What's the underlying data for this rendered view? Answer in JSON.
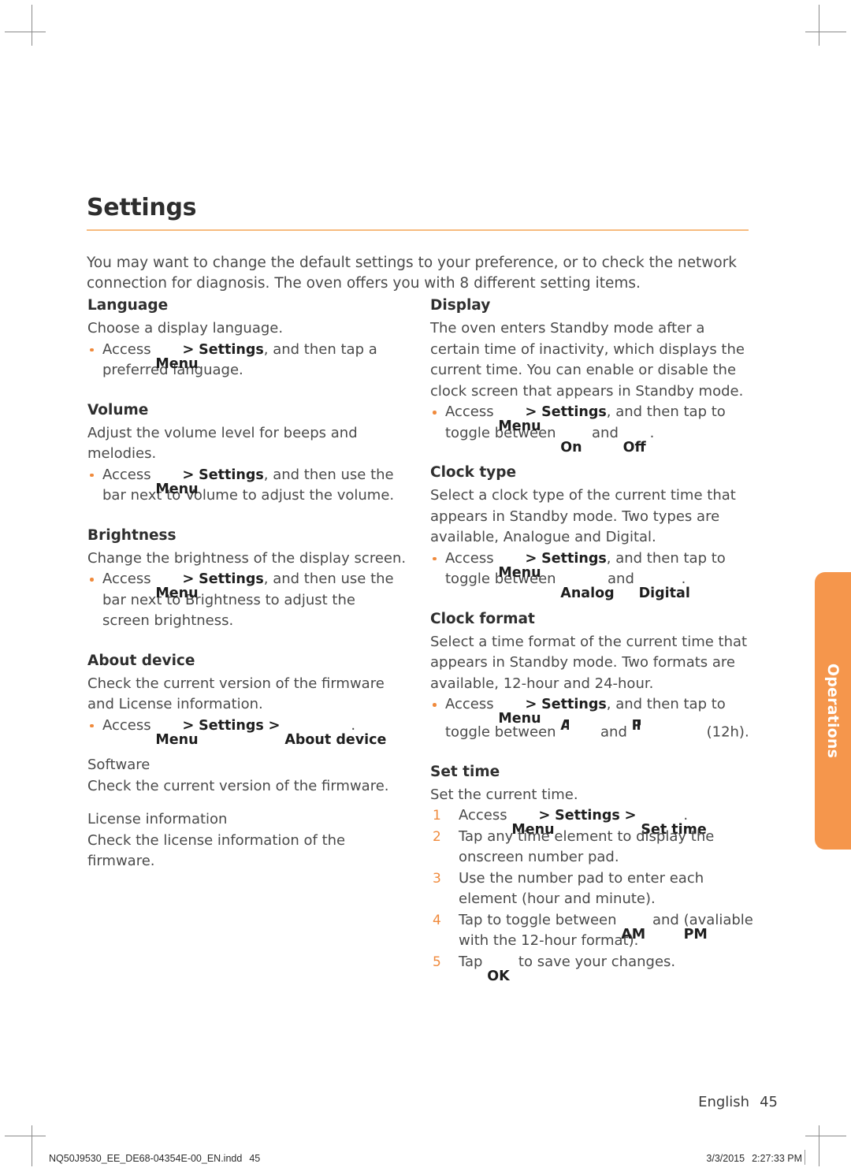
{
  "document": {
    "title": "Settings",
    "intro": "You may want to change the default settings to your preference, or to check the network connection for diagnosis. The oven offers you with 8 different setting items.",
    "accent_color": "#f08a3c",
    "rule_color": "#f7bb7f",
    "tab_color": "#f5964c"
  },
  "side_tab": {
    "label": "Operations"
  },
  "tokens": {
    "menu": "Menu",
    "settings": "Settings",
    "about_device": "About device",
    "set_time": "Set time",
    "on": "On",
    "off": "Off",
    "analog": "Analog",
    "digital": "Digital",
    "am": "AM",
    "pm": "PM",
    "ok": "OK",
    "chevron": ">"
  },
  "left_column": {
    "sections": [
      {
        "heading": "Language",
        "body": "Choose a display language.",
        "bullet_before": "Access ",
        "bullet_mid": ", and then tap a preferred language."
      },
      {
        "heading": "Volume",
        "body": "Adjust the volume level for beeps and melodies.",
        "bullet_before": "Access ",
        "bullet_mid": ", and then use the bar next to Volume to adjust the volume."
      },
      {
        "heading": "Brightness",
        "body": "Change the brightness of the display screen.",
        "bullet_before": "Access ",
        "bullet_mid": ", and then use the bar next to Brightness to adjust the screen brightness."
      },
      {
        "heading": "About device",
        "body": "Check the current version of the firmware and License information.",
        "bullet_before": "Access ",
        "bullet_mid": "."
      }
    ],
    "sub_sections": [
      {
        "heading": "Software",
        "body": "Check the current version of the firmware."
      },
      {
        "heading": "License information",
        "body": "Check the license information of the firmware."
      }
    ]
  },
  "right_column": {
    "sections": [
      {
        "heading": "Display",
        "body": "The oven enters Standby mode after a certain time of inactivity, which displays the current time. You can enable or disable the clock screen that appears in Standby mode.",
        "bullet_before": "Access ",
        "bullet_mid": ", and then tap to toggle between ",
        "bullet_join": " and ",
        "bullet_end": "."
      },
      {
        "heading": "Clock type",
        "body": "Select a clock type of the current time that appears in Standby mode. Two types are available, Analogue and Digital.",
        "bullet_before": "Access ",
        "bullet_mid": ", and then tap to toggle between ",
        "bullet_join": " and ",
        "bullet_end": "."
      },
      {
        "heading": "Clock format",
        "body": "Select a time format of the current time that appears in Standby mode. Two formats are available, 12-hour and 24-hour.",
        "bullet_before": "Access ",
        "bullet_mid": ", and then tap to toggle between ",
        "bullet_join": " and ",
        "bullet_end": "(12h)."
      }
    ],
    "set_time": {
      "heading": "Set time",
      "body": "Set the current time.",
      "steps": [
        {
          "num": "1",
          "before": "Access ",
          "after": "."
        },
        {
          "num": "2",
          "text": "Tap any time element to display the onscreen number pad."
        },
        {
          "num": "3",
          "text": "Use the number pad to enter each element (hour and minute)."
        },
        {
          "num": "4",
          "before": "Tap to toggle between ",
          "join": " and ",
          "after": "(avaliable with the 12-hour format)."
        },
        {
          "num": "5",
          "before": "Tap ",
          "after": " to save your changes."
        }
      ]
    }
  },
  "footer": {
    "language": "English",
    "page_number": "45",
    "filename": "NQ50J9530_EE_DE68-04354E-00_EN.indd",
    "file_page": "45",
    "date": "3/3/2015",
    "time": "2:27:33 PM"
  }
}
